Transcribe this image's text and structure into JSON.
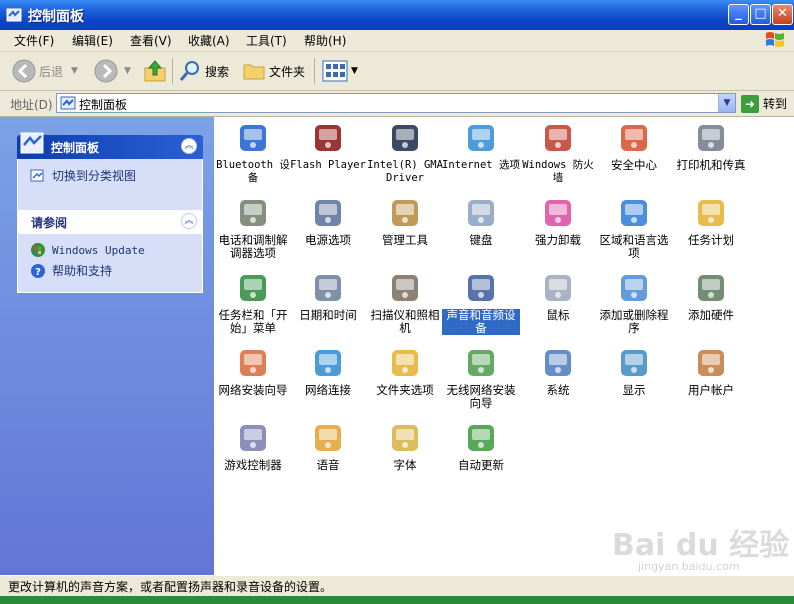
{
  "window": {
    "title": "控制面板"
  },
  "menu": [
    "文件(F)",
    "编辑(E)",
    "查看(V)",
    "收藏(A)",
    "工具(T)",
    "帮助(H)"
  ],
  "toolbar": {
    "back": "后退",
    "search": "搜索",
    "folders": "文件夹"
  },
  "address": {
    "label": "地址(D)",
    "value": "控制面板",
    "go": "转到"
  },
  "sidebar": {
    "panel1": {
      "title": "控制面板",
      "link": "切换到分类视图"
    },
    "panel2": {
      "title": "请参阅",
      "links": [
        "Windows Update",
        "帮助和支持"
      ]
    }
  },
  "items": [
    {
      "label": "Bluetooth 设备",
      "icon": "bluetooth-icon"
    },
    {
      "label": "Flash Player",
      "icon": "flash-icon"
    },
    {
      "label": "Intel(R) GMA Driver",
      "icon": "intel-gma-icon"
    },
    {
      "label": "Internet 选项",
      "icon": "internet-options-icon"
    },
    {
      "label": "Windows 防火墙",
      "icon": "firewall-icon"
    },
    {
      "label": "安全中心",
      "icon": "security-center-icon"
    },
    {
      "label": "打印机和传真",
      "icon": "printer-icon"
    },
    {
      "label": "电话和调制解调器选项",
      "icon": "phone-modem-icon"
    },
    {
      "label": "电源选项",
      "icon": "power-icon"
    },
    {
      "label": "管理工具",
      "icon": "admin-tools-icon"
    },
    {
      "label": "键盘",
      "icon": "keyboard-icon"
    },
    {
      "label": "强力卸载",
      "icon": "uninstall-icon"
    },
    {
      "label": "区域和语言选项",
      "icon": "region-language-icon"
    },
    {
      "label": "任务计划",
      "icon": "scheduled-tasks-icon"
    },
    {
      "label": "任务栏和「开始」菜单",
      "icon": "taskbar-icon"
    },
    {
      "label": "日期和时间",
      "icon": "date-time-icon"
    },
    {
      "label": "扫描仪和照相机",
      "icon": "scanner-camera-icon"
    },
    {
      "label": "声音和音频设备",
      "icon": "sound-icon",
      "selected": true
    },
    {
      "label": "鼠标",
      "icon": "mouse-icon"
    },
    {
      "label": "添加或删除程序",
      "icon": "add-remove-icon"
    },
    {
      "label": "添加硬件",
      "icon": "add-hardware-icon"
    },
    {
      "label": "网络安装向导",
      "icon": "network-wizard-icon"
    },
    {
      "label": "网络连接",
      "icon": "network-connections-icon"
    },
    {
      "label": "文件夹选项",
      "icon": "folder-options-icon"
    },
    {
      "label": "无线网络安装向导",
      "icon": "wireless-wizard-icon"
    },
    {
      "label": "系统",
      "icon": "system-icon"
    },
    {
      "label": "显示",
      "icon": "display-icon"
    },
    {
      "label": "用户帐户",
      "icon": "user-accounts-icon"
    },
    {
      "label": "游戏控制器",
      "icon": "game-controller-icon"
    },
    {
      "label": "语音",
      "icon": "speech-icon"
    },
    {
      "label": "字体",
      "icon": "fonts-icon"
    },
    {
      "label": "自动更新",
      "icon": "auto-update-icon"
    }
  ],
  "status": "更改计算机的声音方案，或者配置扬声器和录音设备的设置。",
  "watermark": {
    "main": "Bai du 经验",
    "sub": "jingyan.baidu.com"
  }
}
